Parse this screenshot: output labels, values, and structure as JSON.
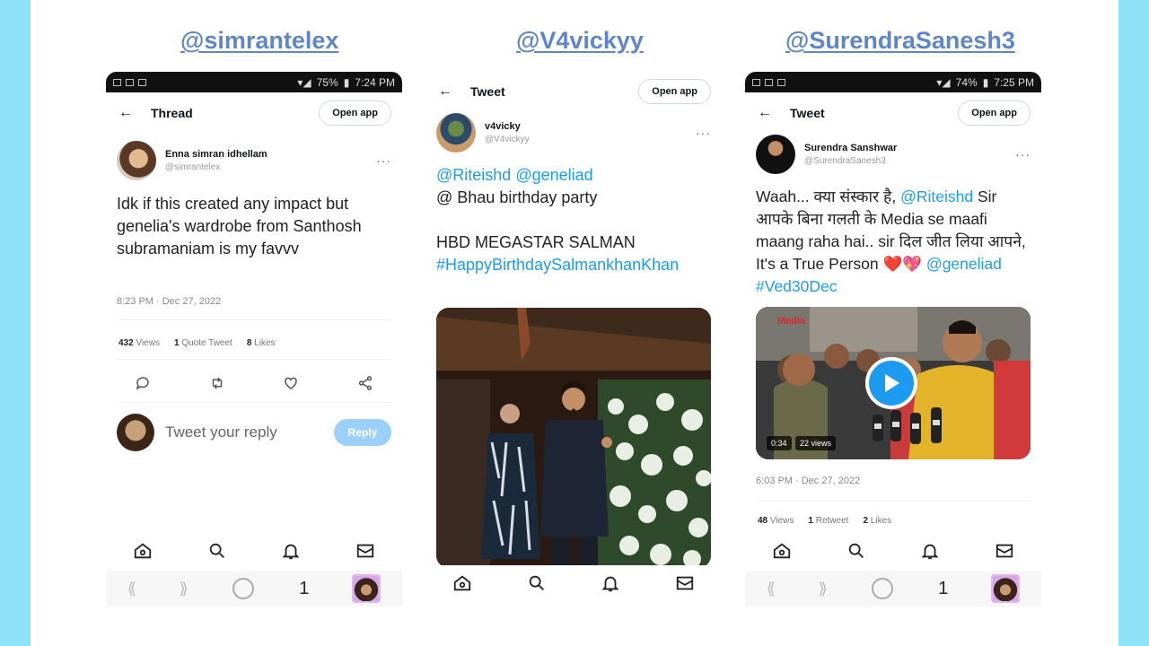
{
  "colors": {
    "background": "#8fe3f8",
    "handle": "#5f86c7",
    "link": "#1d9bf0",
    "reply_button": "#9bd1f9"
  },
  "panels": [
    {
      "handle": "@simrantelex",
      "status_battery": "75%",
      "status_time": "7:24 PM",
      "topbar_title": "Thread",
      "open_app": "Open app",
      "author_name": "Enna simran idhellam",
      "author_handle": "@simrantelex",
      "text": "Idk if this created any impact but genelia's wardrobe from Santhosh subramaniam is my favvv",
      "timestamp": "8:23 PM · Dec 27, 2022",
      "views_count": "432",
      "views_label": "Views",
      "quotes_count": "1",
      "quotes_label": "Quote Tweet",
      "likes_count": "8",
      "likes_label": "Likes",
      "reply_placeholder": "Tweet your reply",
      "reply_button": "Reply",
      "tab_count": "1"
    },
    {
      "handle": "@V4vickyy",
      "topbar_title": "Tweet",
      "open_app": "Open app",
      "author_name": "v4vicky",
      "author_handle": "@V4vickyy",
      "mention1": "@Riteishd",
      "mention2": "@geneliad",
      "line2": "@ Bhau  birthday party",
      "line3": "HBD MEGASTAR SALMAN",
      "hashtag": "#HappyBirthdaySalmankhanKhan"
    },
    {
      "handle": "@SurendraSanesh3",
      "status_battery": "74%",
      "status_time": "7:25 PM",
      "topbar_title": "Tweet",
      "open_app": "Open app",
      "author_name": "Surendra Sanshwar",
      "author_handle": "@SurendraSanesh3",
      "text_a": "Waah... क्या संस्कार है, ",
      "mention": "@Riteishd",
      "text_b": " Sir आपके बिना गलती के Media se maafi maang raha hai..  sir दिल जीत लिया आपने, It's a True Person ",
      "hearts": "❤️💖",
      "tags": " @geneliad #Ved30Dec",
      "video_logo": "Media",
      "video_time": "0:34",
      "video_views": "22 views",
      "timestamp": "6:03 PM · Dec 27, 2022",
      "views_count": "48",
      "views_label": "Views",
      "retweets_count": "1",
      "retweets_label": "Retweet",
      "likes_count": "2",
      "likes_label": "Likes",
      "tab_count": "1"
    }
  ]
}
